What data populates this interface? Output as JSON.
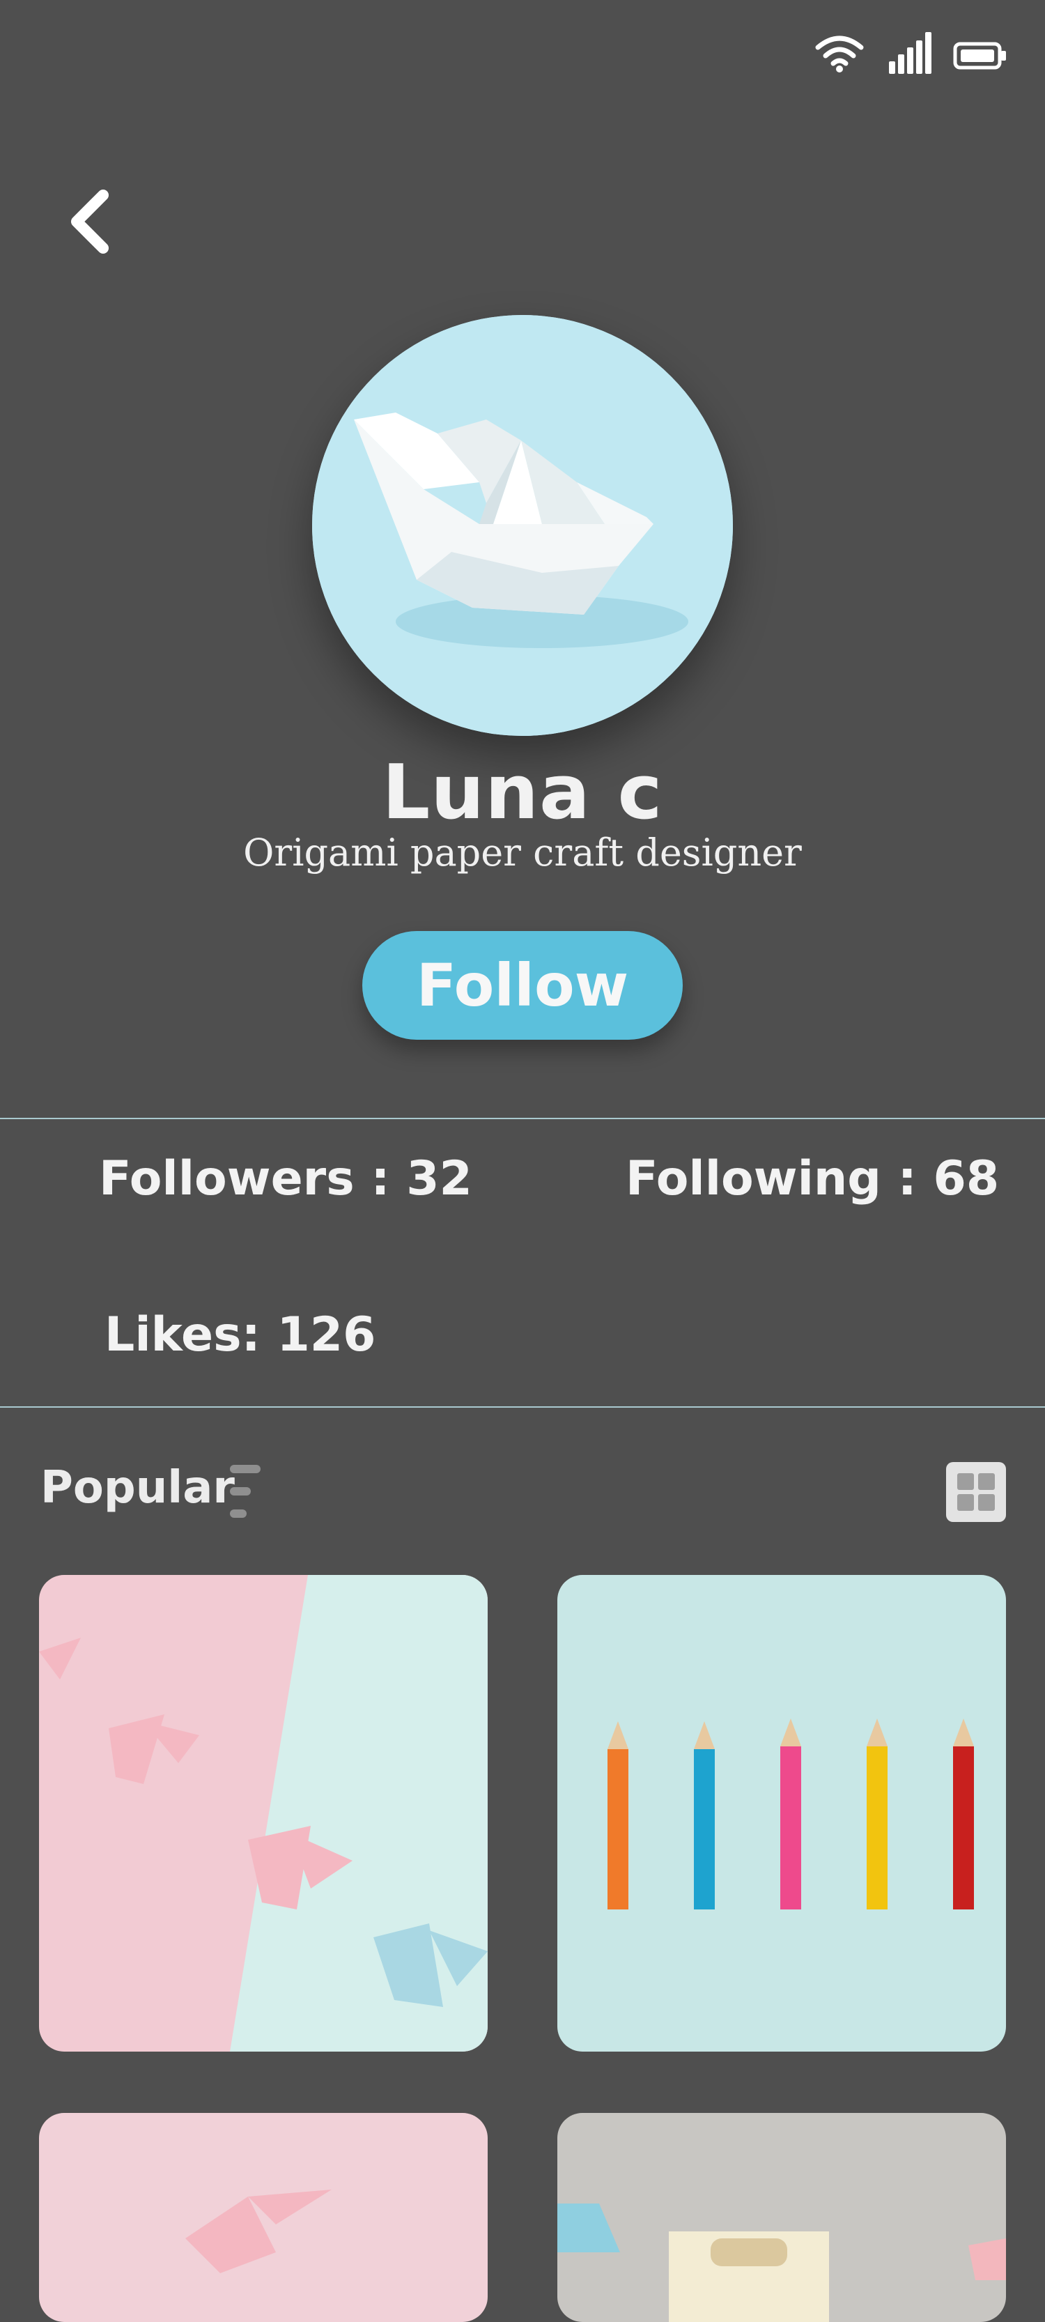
{
  "status_bar": {
    "icons": [
      "wifi-icon",
      "signal-icon",
      "battery-icon"
    ]
  },
  "navigation": {
    "back_icon": "chevron-left-icon"
  },
  "profile": {
    "avatar_alt": "paper boat origami",
    "name": "Luna c",
    "subtitle": "Origami paper craft designer",
    "follow_label": "Follow"
  },
  "stats": {
    "followers": "Followers : 32",
    "following": "Following : 68",
    "likes": "Likes: 126"
  },
  "section": {
    "title": "Popular",
    "sort_icon": "sort-icon",
    "view_icon": "grid-view-icon"
  },
  "gallery": [
    {
      "subject": "pink and blue origami cranes"
    },
    {
      "subject": "colored pencils"
    },
    {
      "subject": "pink origami crane"
    },
    {
      "subject": "paper gift bags"
    }
  ],
  "colors": {
    "background": "#4f4f4f",
    "accent": "#5bc0dc",
    "divider": "#a9c9cf"
  }
}
